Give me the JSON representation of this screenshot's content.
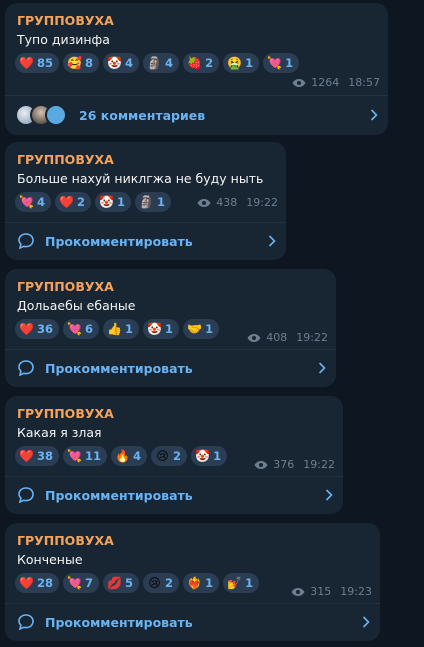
{
  "messages": [
    {
      "sender": "ГРУППОВУХА",
      "text": "Тупо дизинфа",
      "reactions": [
        {
          "emoji": "❤️",
          "count": "85"
        },
        {
          "emoji": "🥰",
          "count": "8"
        },
        {
          "emoji": "🤡",
          "count": "4"
        },
        {
          "emoji": "🗿",
          "count": "4"
        },
        {
          "emoji": "🍓",
          "count": "2"
        },
        {
          "emoji": "🤮",
          "count": "1"
        },
        {
          "emoji": "💘",
          "count": "1"
        }
      ],
      "views": "1264",
      "time": "18:57",
      "comments": "26 комментариев"
    },
    {
      "sender": "ГРУППОВУХА",
      "text": "Больше нахуй никлгжа не буду ныть",
      "reactions": [
        {
          "emoji": "💘",
          "count": "4"
        },
        {
          "emoji": "❤️",
          "count": "2"
        },
        {
          "emoji": "🤡",
          "count": "1"
        },
        {
          "emoji": "🗿",
          "count": "1"
        }
      ],
      "views": "438",
      "time": "19:22",
      "comments": "Прокомментировать"
    },
    {
      "sender": "ГРУППОВУХА",
      "text": "Дольаебы ебаные",
      "reactions": [
        {
          "emoji": "❤️",
          "count": "36"
        },
        {
          "emoji": "💘",
          "count": "6"
        },
        {
          "emoji": "👍",
          "count": "1"
        },
        {
          "emoji": "🤡",
          "count": "1"
        },
        {
          "emoji": "🤝",
          "count": "1"
        }
      ],
      "views": "408",
      "time": "19:22",
      "comments": "Прокомментировать"
    },
    {
      "sender": "ГРУППОВУХА",
      "text": "Какая я злая",
      "reactions": [
        {
          "emoji": "❤️",
          "count": "38"
        },
        {
          "emoji": "💘",
          "count": "11"
        },
        {
          "emoji": "🔥",
          "count": "4"
        },
        {
          "emoji": "😢",
          "count": "2"
        },
        {
          "emoji": "🤡",
          "count": "1"
        }
      ],
      "views": "376",
      "time": "19:22",
      "comments": "Прокомментировать"
    },
    {
      "sender": "ГРУППОВУХА",
      "text": "Конченые",
      "reactions": [
        {
          "emoji": "❤️",
          "count": "28"
        },
        {
          "emoji": "💘",
          "count": "7"
        },
        {
          "emoji": "💋",
          "count": "5"
        },
        {
          "emoji": "😢",
          "count": "2"
        },
        {
          "emoji": "❤️‍🔥",
          "count": "1"
        },
        {
          "emoji": "💅",
          "count": "1"
        }
      ],
      "views": "315",
      "time": "19:23",
      "comments": "Прокомментировать"
    }
  ],
  "colors": {
    "background": "#0e1621",
    "bubble": "#182533",
    "sender": "#f5a35b",
    "accent": "#6ab3f3",
    "meta": "#6d7f8f"
  },
  "icons": {
    "views": "eye-icon",
    "comment": "comment-bubble-icon",
    "chevron": "chevron-right-icon"
  }
}
